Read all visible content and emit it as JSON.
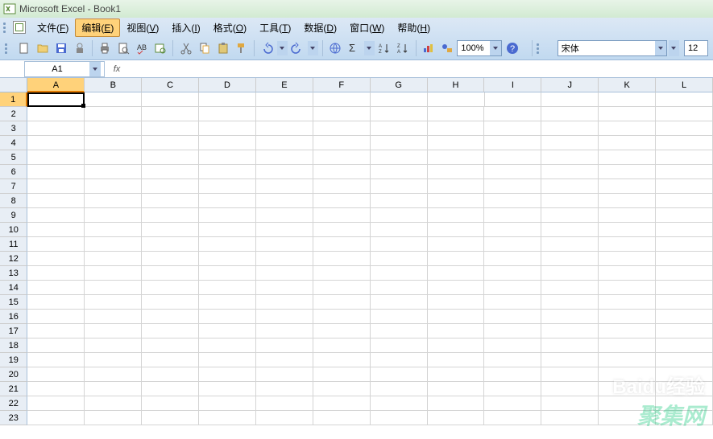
{
  "window": {
    "title": "Microsoft Excel - Book1"
  },
  "menu": {
    "items": [
      {
        "label": "文件(F)",
        "key": "F"
      },
      {
        "label": "编辑(E)",
        "key": "E",
        "active": true
      },
      {
        "label": "视图(V)",
        "key": "V"
      },
      {
        "label": "插入(I)",
        "key": "I"
      },
      {
        "label": "格式(O)",
        "key": "O"
      },
      {
        "label": "工具(T)",
        "key": "T"
      },
      {
        "label": "数据(D)",
        "key": "D"
      },
      {
        "label": "窗口(W)",
        "key": "W"
      },
      {
        "label": "帮助(H)",
        "key": "H"
      }
    ]
  },
  "toolbar": {
    "zoom": "100%",
    "icons": {
      "new": "#5a8a3a",
      "open": "#e0a840",
      "save": "#4a6ad0",
      "permissions": "#888",
      "print": "#666",
      "preview": "#666",
      "spelling": "#4a6ad0",
      "research": "#5a8a3a",
      "cut": "#666",
      "copy": "#e0a840",
      "paste": "#e0a840",
      "painter": "#e0a840",
      "undo": "#4a6ad0",
      "redo": "#4a6ad0",
      "link": "#4a6ad0",
      "sum": "#333",
      "sortasc": "#333",
      "sortdesc": "#333",
      "chart": "#c04a4a",
      "drawing": "#e0a840",
      "help": "#4a6ad0"
    }
  },
  "font": {
    "name": "宋体",
    "size": "12"
  },
  "formula": {
    "name_box": "A1",
    "fx": "fx",
    "value": ""
  },
  "grid": {
    "columns": [
      "A",
      "B",
      "C",
      "D",
      "E",
      "F",
      "G",
      "H",
      "I",
      "J",
      "K",
      "L"
    ],
    "row_count": 23,
    "selected_cell": {
      "col": "A",
      "row": 1
    }
  },
  "watermark": {
    "line1": "Baidu经验",
    "line2": "聚集网"
  }
}
